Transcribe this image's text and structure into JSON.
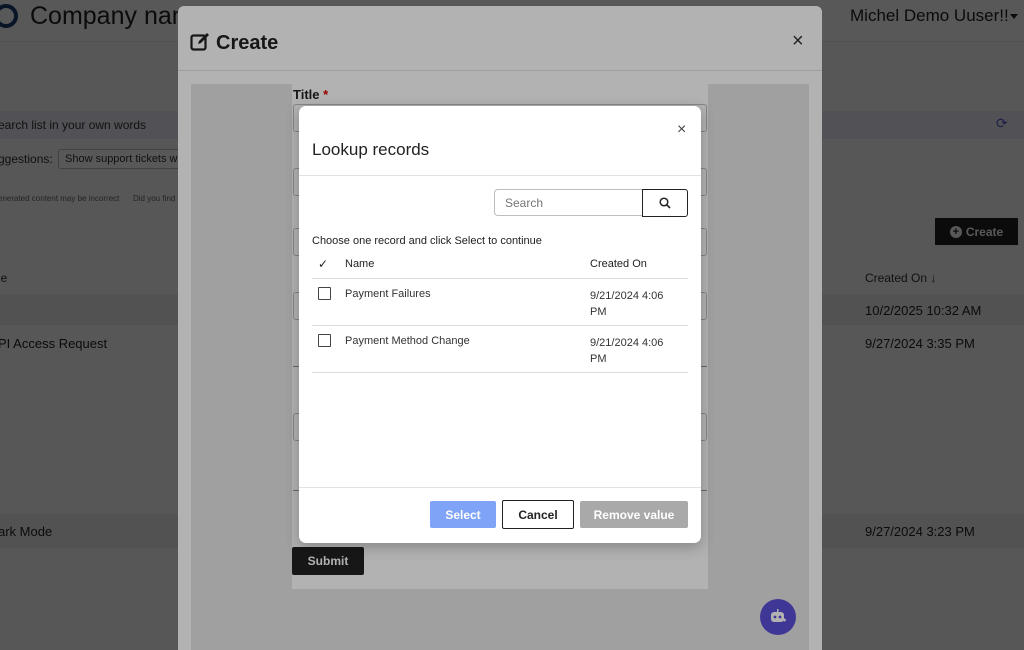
{
  "topbar": {
    "company_name": "Company nam",
    "user_name": "Michel Demo Uuser!!"
  },
  "background": {
    "search_placeholder": "earch list in your own words",
    "suggestions_label": "ggestions:",
    "suggestion_chip": "Show support tickets wit",
    "ai_note": "enerated content may be incorrect",
    "ai_note_question": "Did you find",
    "create_button": "Create",
    "columns": {
      "title": "le",
      "created_on": "Created On ↓"
    },
    "rows": [
      {
        "title": "",
        "created": "10/2/2025 10:32 AM"
      },
      {
        "title": "PI Access Request",
        "created": "9/27/2024 3:35 PM"
      },
      {
        "title": "ark Mode",
        "created": "9/27/2024 3:23 PM"
      }
    ]
  },
  "create_modal": {
    "title": "Create",
    "fields": {
      "title_label": "Title",
      "required_mark": "*"
    },
    "submit_label": "Submit"
  },
  "lookup": {
    "title": "Lookup records",
    "search_placeholder": "Search",
    "instruction": "Choose one record and click Select to continue",
    "columns": {
      "check": "✓",
      "name": "Name",
      "created_on": "Created On"
    },
    "rows": [
      {
        "name": "Payment Failures",
        "created_on": "9/21/2024 4:06 PM"
      },
      {
        "name": "Payment Method Change",
        "created_on": "9/21/2024 4:06 PM"
      }
    ],
    "buttons": {
      "select": "Select",
      "cancel": "Cancel",
      "remove": "Remove value"
    }
  },
  "colors": {
    "accent": "#7fa3f7",
    "chat_fab": "#5b4fd6",
    "dark_button": "#222222"
  }
}
